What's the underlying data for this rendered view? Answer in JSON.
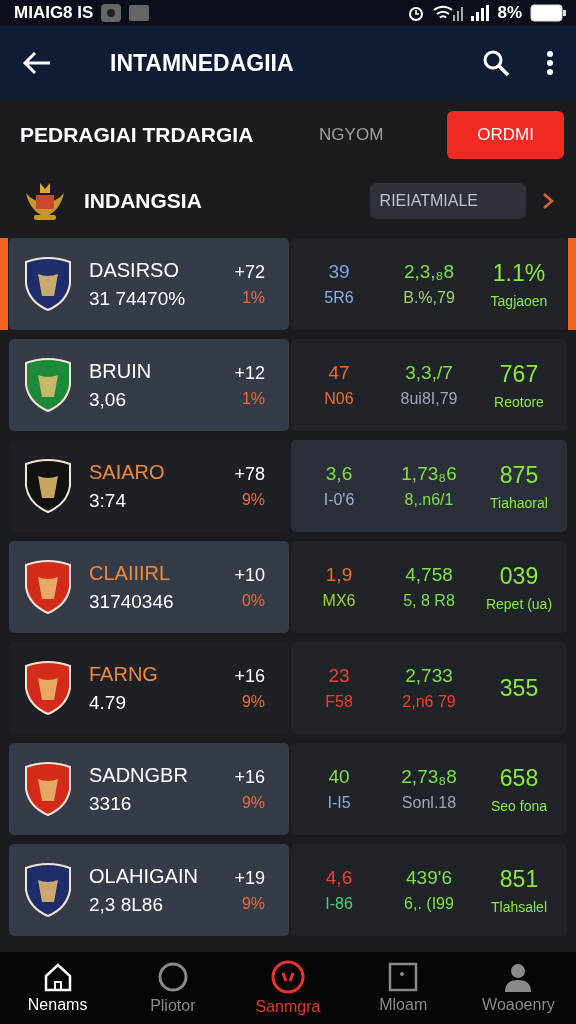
{
  "status_bar": {
    "carrier": "MIAIG8 IS",
    "battery": "8%"
  },
  "app_bar": {
    "title": "INTAMNEDAGIIA"
  },
  "header": {
    "title": "PEDRAGIAI TRDARGIA",
    "tabs": [
      {
        "label": "NGYOM",
        "selected": false
      },
      {
        "label": "ORDMI",
        "selected": true
      }
    ]
  },
  "league": {
    "name": "INDANGSIA",
    "filter": "RIEIATMIALE"
  },
  "rows": [
    {
      "selected": true,
      "team_highlighted": true,
      "stats_highlighted": false,
      "crest": {
        "color": "#1e2d6b"
      },
      "name": {
        "text": "DASIRSO",
        "color": "#ffffff"
      },
      "score": "31 74470%",
      "change": "+72",
      "change_pct": "1%",
      "stats": [
        {
          "value": {
            "text": "39",
            "color": "#7fa8e0"
          },
          "label": {
            "text": "5R6",
            "color": "#8fb0e0"
          }
        },
        {
          "value": {
            "text": "2,3,₈8",
            "color": "#7ee04a"
          },
          "label": {
            "text": "B.%,79",
            "color": "#a8d070"
          }
        },
        {
          "value": {
            "text": "1.1%",
            "color": "#8aeb3c"
          },
          "label": {
            "text": "Tagjaoen",
            "color": "#8aeb3c"
          }
        }
      ]
    },
    {
      "selected": false,
      "team_highlighted": true,
      "stats_highlighted": false,
      "crest": {
        "color": "#1d8a3a"
      },
      "name": {
        "text": "BRUIN",
        "color": "#ffffff"
      },
      "score": "3,06",
      "change": "+12",
      "change_pct": "1%",
      "stats": [
        {
          "value": {
            "text": "47",
            "color": "#f06a2a"
          },
          "label": {
            "text": "N06",
            "color": "#f06a2a"
          }
        },
        {
          "value": {
            "text": "3,3,/7",
            "color": "#7ee04a"
          },
          "label": {
            "text": "8ui8I,79",
            "color": "#a0a8b8"
          }
        },
        {
          "value": {
            "text": "767",
            "color": "#8aeb3c"
          },
          "label": {
            "text": "Reotore",
            "color": "#8aeb3c"
          }
        }
      ]
    },
    {
      "selected": false,
      "team_highlighted": false,
      "stats_highlighted": true,
      "crest": {
        "color": "#111111"
      },
      "name": {
        "text": "SAIARO",
        "color": "#f08a3a"
      },
      "score": "3:74",
      "change": "+78",
      "change_pct": "9%",
      "stats": [
        {
          "value": {
            "text": "3,6",
            "color": "#7ee04a"
          },
          "label": {
            "text": "I-0'6",
            "color": "#a0b0d0"
          }
        },
        {
          "value": {
            "text": "1,73₈6",
            "color": "#7ee04a"
          },
          "label": {
            "text": "8,.n6/1",
            "color": "#7ee04a"
          }
        },
        {
          "value": {
            "text": "875",
            "color": "#8aeb3c"
          },
          "label": {
            "text": "Tiahaoral",
            "color": "#8aeb3c"
          }
        }
      ]
    },
    {
      "selected": false,
      "team_highlighted": true,
      "stats_highlighted": false,
      "crest": {
        "color": "#d42a1a"
      },
      "name": {
        "text": "CLAIIIRL",
        "color": "#f08a3a"
      },
      "score": "31740346",
      "change": "+10",
      "change_pct": "0%",
      "stats": [
        {
          "value": {
            "text": "1,9",
            "color": "#f06a2a"
          },
          "label": {
            "text": "MX6",
            "color": "#a8d040"
          }
        },
        {
          "value": {
            "text": "4,758",
            "color": "#7ee04a"
          },
          "label": {
            "text": "5, 8 R8",
            "color": "#7ee04a"
          }
        },
        {
          "value": {
            "text": "039",
            "color": "#8aeb3c"
          },
          "label": {
            "text": "Repet (ua)",
            "color": "#8aeb3c"
          }
        }
      ]
    },
    {
      "selected": false,
      "team_highlighted": false,
      "stats_highlighted": false,
      "crest": {
        "color": "#d42a1a"
      },
      "name": {
        "text": "FARNG",
        "color": "#f08a3a"
      },
      "score": "4.79",
      "change": "+16",
      "change_pct": "9%",
      "stats": [
        {
          "value": {
            "text": "23",
            "color": "#f0402a"
          },
          "label": {
            "text": "F58",
            "color": "#f0402a"
          }
        },
        {
          "value": {
            "text": "2,733",
            "color": "#7ee04a"
          },
          "label": {
            "text": "2,n6 79",
            "color": "#f0402a"
          }
        },
        {
          "value": {
            "text": "355",
            "color": "#8aeb3c"
          }
        }
      ]
    },
    {
      "selected": false,
      "team_highlighted": true,
      "stats_highlighted": false,
      "crest": {
        "color": "#d42a1a"
      },
      "name": {
        "text": "SADNGBR",
        "color": "#ffffff"
      },
      "score": "3316",
      "change": "+16",
      "change_pct": "9%",
      "stats": [
        {
          "value": {
            "text": "40",
            "color": "#7ee04a"
          },
          "label": {
            "text": "I-I5",
            "color": "#8fb0e0"
          }
        },
        {
          "value": {
            "text": "2,73₈8",
            "color": "#7ee04a"
          },
          "label": {
            "text": "Sonl.18",
            "color": "#a0a8b8"
          }
        },
        {
          "value": {
            "text": "658",
            "color": "#8aeb3c"
          },
          "label": {
            "text": "Seo fona",
            "color": "#8aeb3c"
          }
        }
      ]
    },
    {
      "selected": false,
      "team_highlighted": true,
      "stats_highlighted": false,
      "crest": {
        "color": "#1e2d6b"
      },
      "name": {
        "text": "OLAHIGAIN",
        "color": "#ffffff"
      },
      "score": "2,3 8L86",
      "change": "+19",
      "change_pct": "9%",
      "stats": [
        {
          "value": {
            "text": "4,6",
            "color": "#f0402a"
          },
          "label": {
            "text": "I-86",
            "color": "#4ad070"
          }
        },
        {
          "value": {
            "text": "439'6",
            "color": "#7ee04a"
          },
          "label": {
            "text": "6,. (I99",
            "color": "#7ee04a"
          }
        },
        {
          "value": {
            "text": "851",
            "color": "#8aeb3c"
          },
          "label": {
            "text": "Tlahsalel",
            "color": "#8aeb3c"
          }
        }
      ]
    }
  ],
  "nav": [
    {
      "kind": "home",
      "label": "Nenams",
      "selected": false
    },
    {
      "kind": "circle",
      "label": "Pliotor",
      "selected": false
    },
    {
      "kind": "ball",
      "label": "Sanmgra",
      "selected": true
    },
    {
      "kind": "square",
      "label": "Mloam",
      "selected": false
    },
    {
      "kind": "person",
      "label": "Woaoenry",
      "selected": false
    }
  ]
}
